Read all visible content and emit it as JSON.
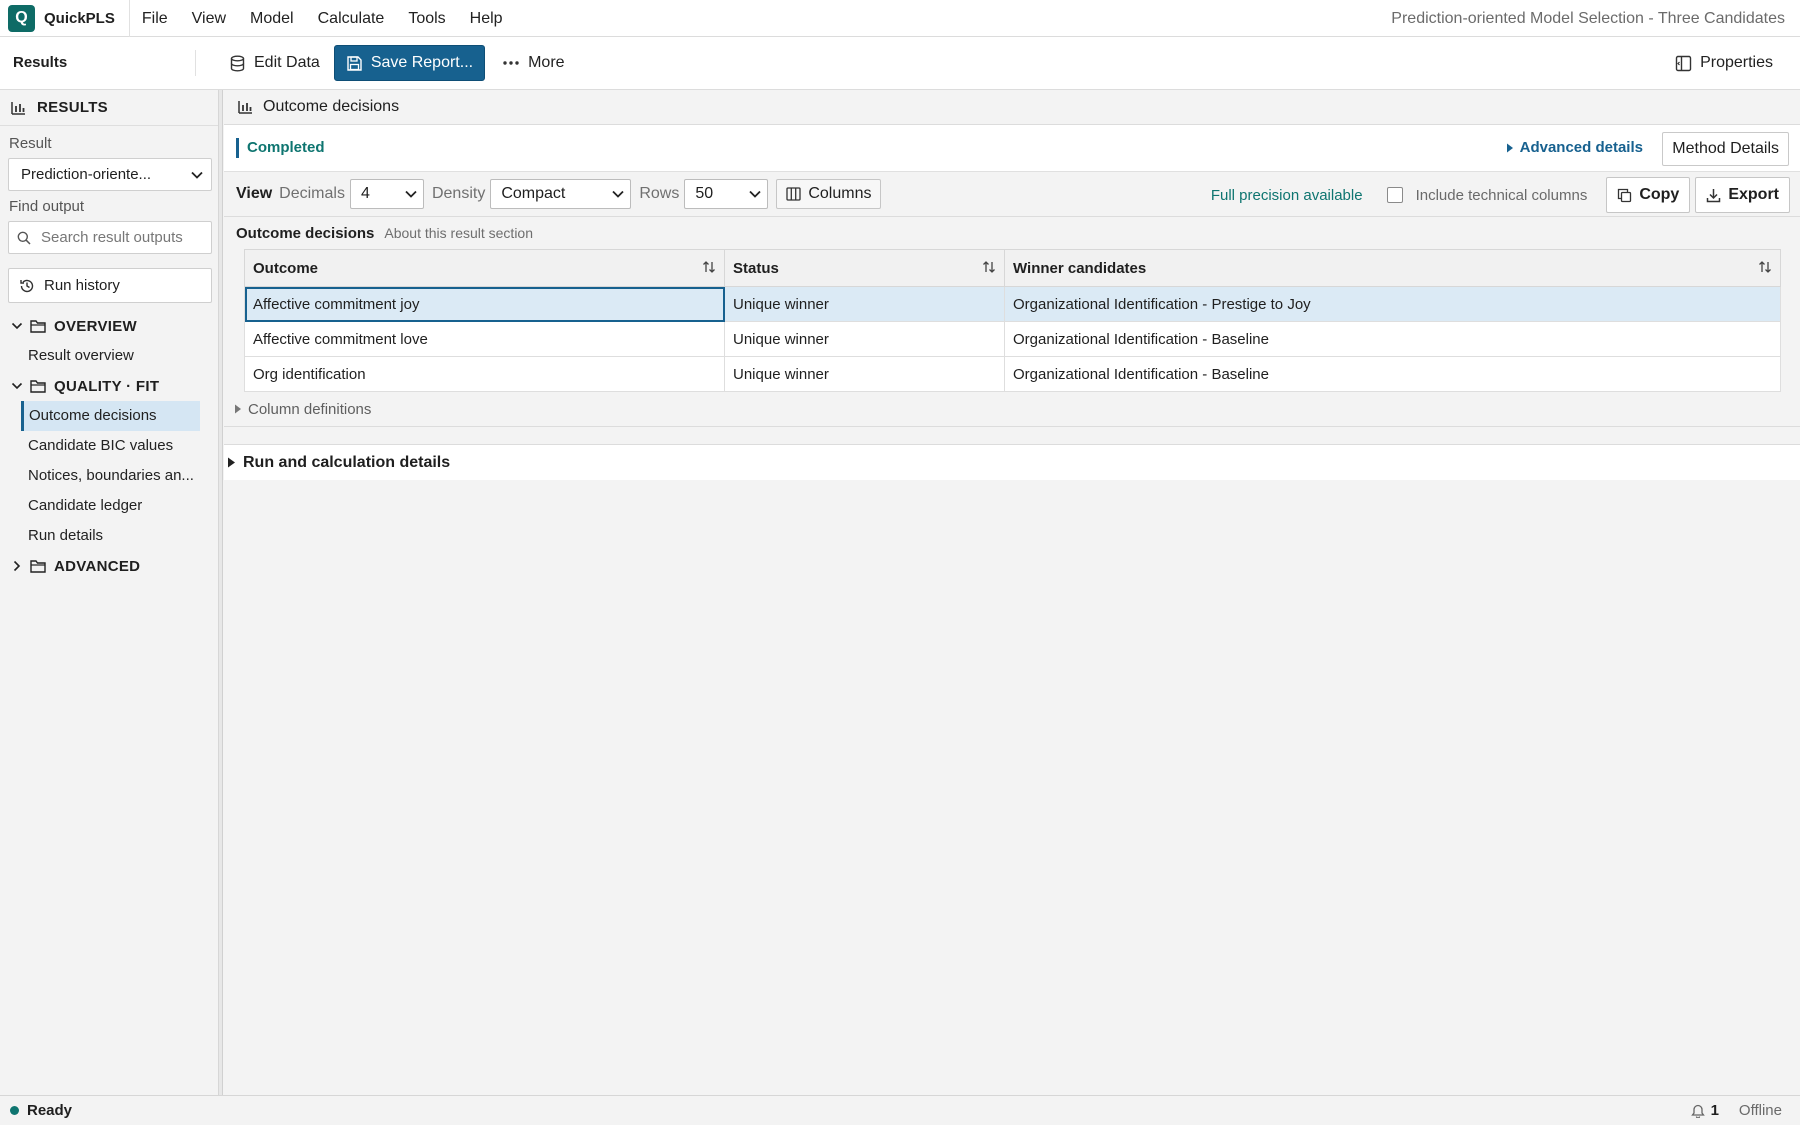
{
  "app": {
    "logo_letter": "Q",
    "name": "QuickPLS",
    "document_title": "Prediction-oriented Model Selection - Three Candidates",
    "accent_color": "#17618f",
    "brand_color": "#0e6b66"
  },
  "menu": [
    "File",
    "View",
    "Model",
    "Calculate",
    "Tools",
    "Help"
  ],
  "toolbar": {
    "section_label": "Results",
    "edit_data": "Edit Data",
    "save_report": "Save Report...",
    "more": "More",
    "properties": "Properties"
  },
  "sidebar": {
    "header": "RESULTS",
    "result_label": "Result",
    "result_value": "Prediction-oriente...",
    "find_label": "Find output",
    "search_placeholder": "Search result outputs",
    "run_history": "Run history",
    "groups": [
      {
        "label": "OVERVIEW",
        "expanded": true,
        "items": [
          "Result overview"
        ]
      },
      {
        "label": "QUALITY · FIT",
        "expanded": true,
        "items": [
          "Outcome decisions",
          "Candidate BIC values",
          "Notices, boundaries an...",
          "Candidate ledger",
          "Run details"
        ]
      },
      {
        "label": "ADVANCED",
        "expanded": false,
        "items": []
      }
    ],
    "active_item": "Outcome decisions"
  },
  "main": {
    "header": "Outcome decisions",
    "status": "Completed",
    "advanced_details": "Advanced details",
    "method_details": "Method Details",
    "view": {
      "label": "View",
      "decimals_label": "Decimals",
      "decimals_value": "4",
      "density_label": "Density",
      "density_value": "Compact",
      "rows_label": "Rows",
      "rows_value": "50",
      "columns_button": "Columns",
      "precision_note": "Full precision available",
      "include_technical": "Include technical columns",
      "include_technical_checked": false,
      "copy": "Copy",
      "export": "Export"
    },
    "section_title": "Outcome decisions",
    "section_subtitle": "About this result section",
    "table": {
      "columns": [
        "Outcome",
        "Status",
        "Winner candidates"
      ],
      "rows": [
        [
          "Affective commitment joy",
          "Unique winner",
          "Organizational Identification - Prestige to Joy"
        ],
        [
          "Affective commitment love",
          "Unique winner",
          "Organizational Identification - Baseline"
        ],
        [
          "Org identification",
          "Unique winner",
          "Organizational Identification - Baseline"
        ]
      ],
      "selected_row": 0
    },
    "column_definitions": "Column definitions",
    "run_details": "Run and calculation details"
  },
  "statusbar": {
    "status": "Ready",
    "notification_count": "1",
    "connection": "Offline"
  }
}
